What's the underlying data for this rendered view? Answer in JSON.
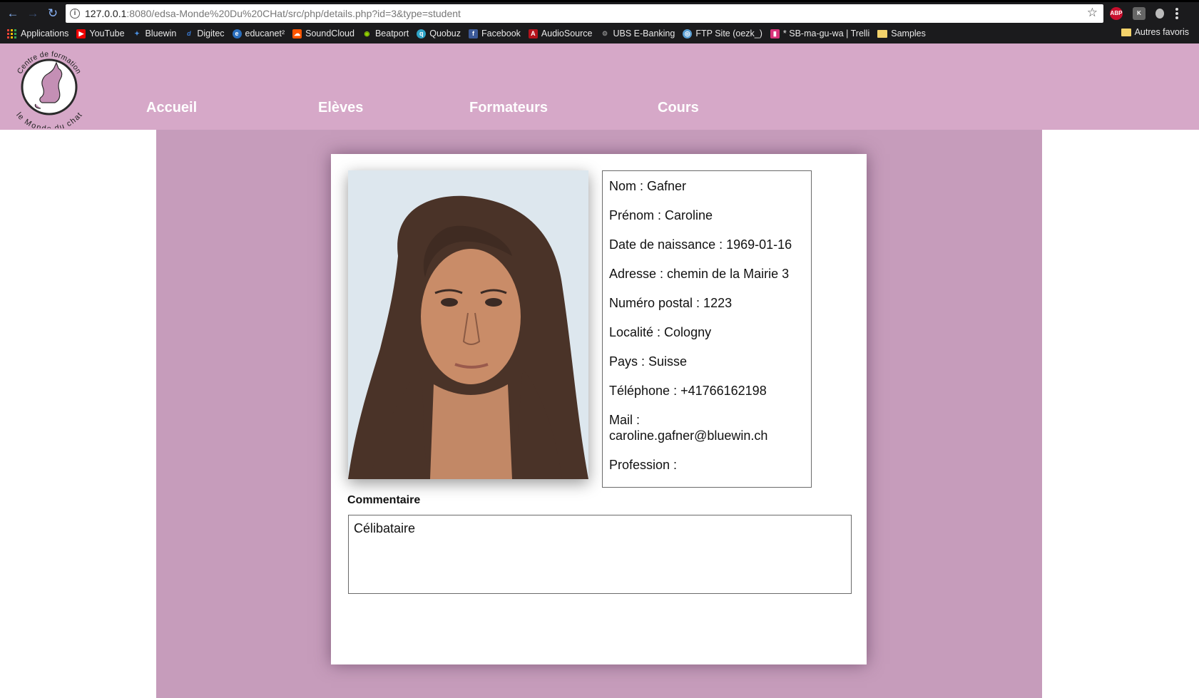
{
  "browser": {
    "url_host": "127.0.0.1",
    "url_rest": ":8080/edsa-Monde%20Du%20CHat/src/php/details.php?id=3&type=student",
    "bookmarks": [
      "Applications",
      "YouTube",
      "Bluewin",
      "Digitec",
      "educanet²",
      "SoundCloud",
      "Beatport",
      "Quobuz",
      "Facebook",
      "AudioSource",
      "UBS E-Banking",
      "FTP Site (oezk_)",
      "* SB-ma-gu-wa | Trelli",
      "Samples"
    ],
    "other_bookmarks": "Autres favoris",
    "ext_abp": "ABP",
    "ext_k": "K"
  },
  "logo": {
    "text_top": "Centre de formation",
    "text_bottom": "le Monde du chat"
  },
  "nav": {
    "accueil": "Accueil",
    "eleves": "Elèves",
    "formateurs": "Formateurs",
    "cours": "Cours"
  },
  "student": {
    "nom": "Nom : Gafner",
    "prenom": "Prénom : Caroline",
    "naissance": "Date de naissance : 1969-01-16",
    "adresse": "Adresse : chemin de la Mairie 3",
    "postal": "Numéro postal : 1223",
    "localite": "Localité : Cologny",
    "pays": "Pays : Suisse",
    "telephone": "Téléphone : +41766162198",
    "mail_label": "Mail :",
    "mail": "caroline.gafner@bluewin.ch",
    "profession": "Profession :"
  },
  "comment": {
    "label": "Commentaire",
    "text": "Célibataire"
  },
  "colors": {
    "header": "#d6a8c8",
    "content": "#c69cbb"
  }
}
